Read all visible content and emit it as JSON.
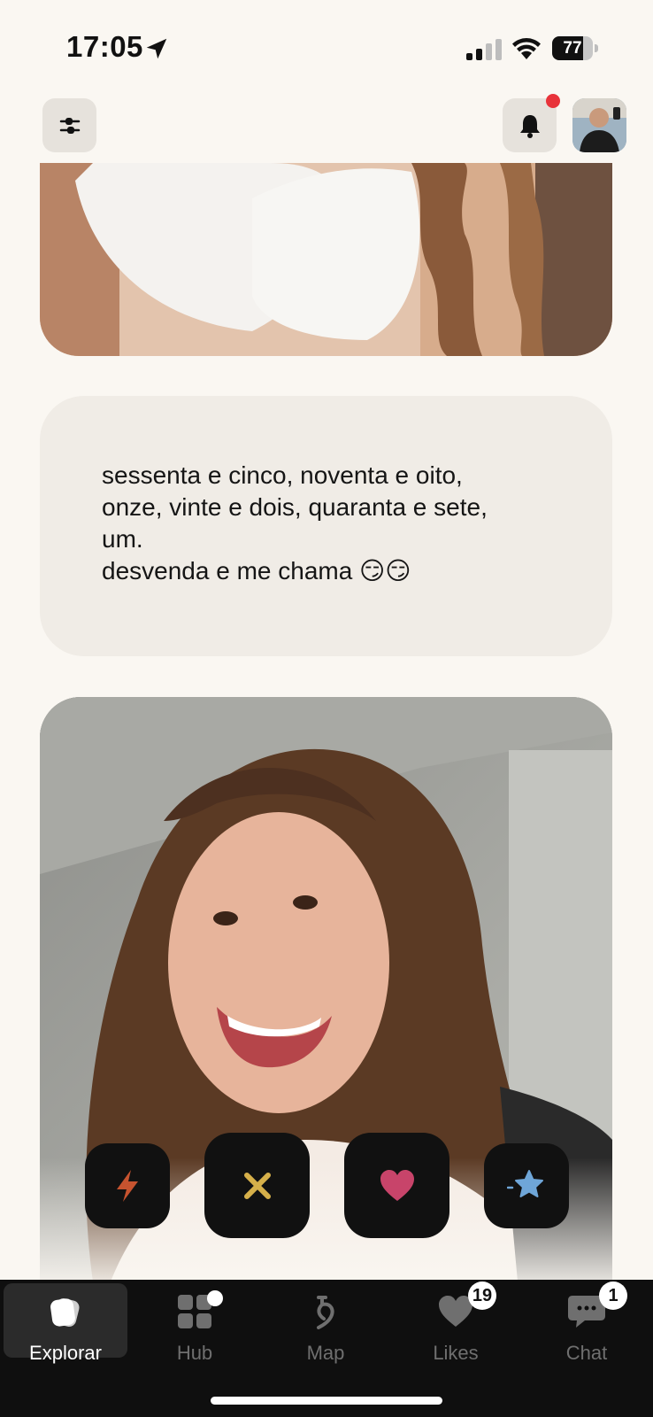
{
  "status_bar": {
    "time": "17:05",
    "battery": "77",
    "battery_level": 0.77,
    "icons": [
      "location-arrow-icon",
      "cellular-signal-icon",
      "wifi-icon",
      "battery-icon"
    ]
  },
  "header": {
    "filter_icon": "sliders-icon",
    "notifications_icon": "bell-icon",
    "has_unread_notifications": true,
    "accent_color": "#e8333a"
  },
  "prompt": {
    "lines": [
      "sessenta e cinco, noventa e oito,",
      "onze, vinte e dois, quaranta e sete,",
      "um.",
      "desvenda e me chama 😏😏"
    ]
  },
  "actions": [
    {
      "name": "boost",
      "icon": "lightning-icon",
      "color": "#c6532f"
    },
    {
      "name": "pass",
      "icon": "x-icon",
      "color": "#d6b04a"
    },
    {
      "name": "like",
      "icon": "heart-icon",
      "color": "#c8446a"
    },
    {
      "name": "super-like",
      "icon": "star-icon",
      "color": "#6fa6d8"
    }
  ],
  "bottom_nav": {
    "items": [
      {
        "label": "Explorar",
        "icon": "cards-icon",
        "active": true
      },
      {
        "label": "Hub",
        "icon": "grid-icon",
        "dot": true
      },
      {
        "label": "Map",
        "icon": "map-icon"
      },
      {
        "label": "Likes",
        "icon": "heart-icon",
        "badge": "19"
      },
      {
        "label": "Chat",
        "icon": "chat-icon",
        "badge": "1"
      }
    ]
  }
}
